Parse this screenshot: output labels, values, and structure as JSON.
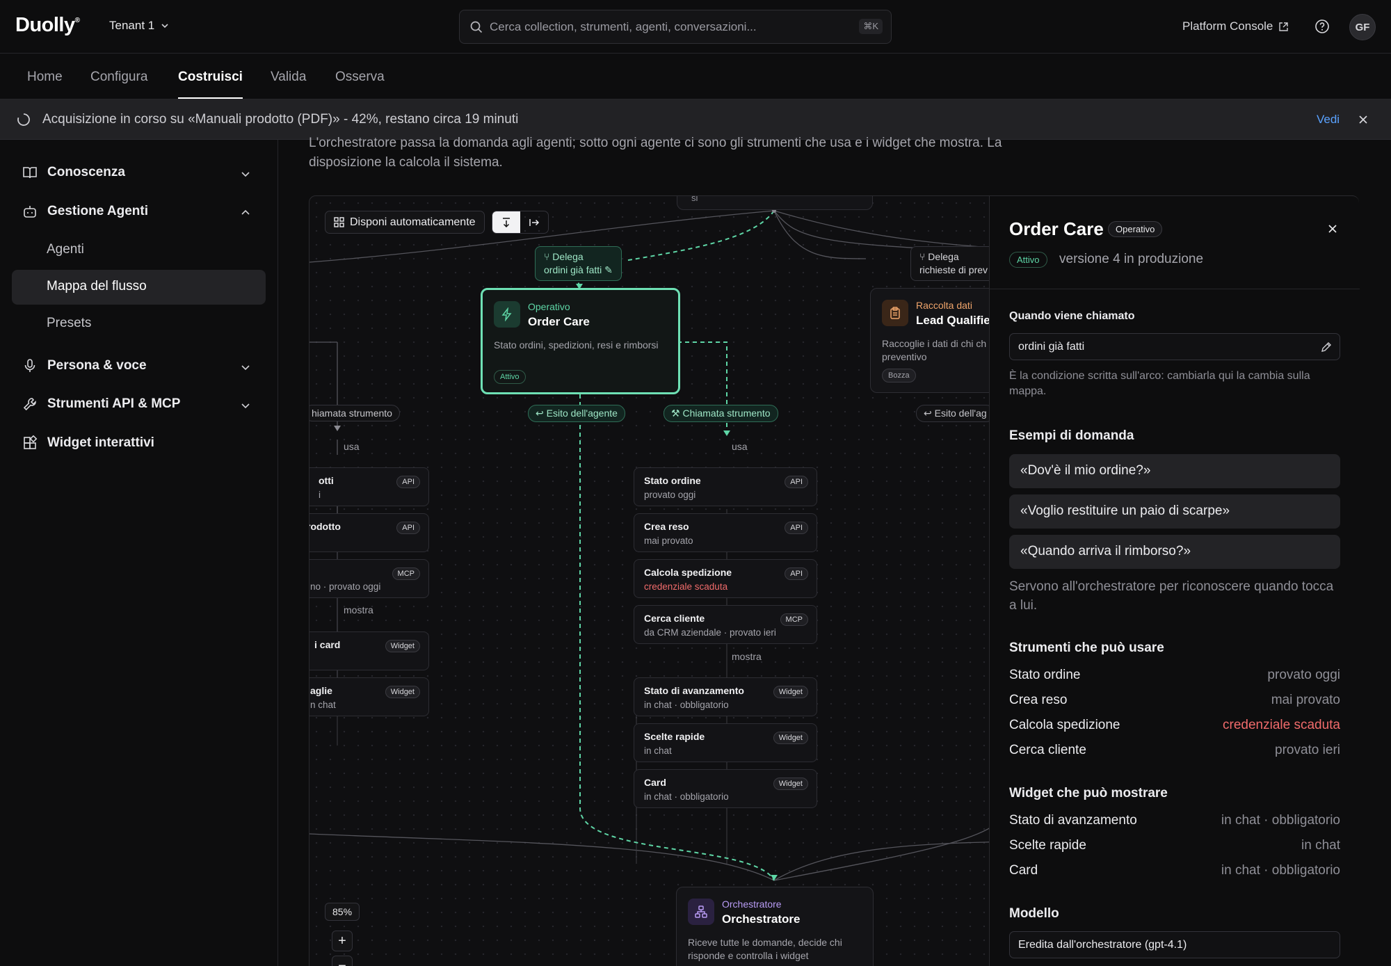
{
  "header": {
    "logo": "Duolly",
    "tenant": "Tenant 1",
    "search_placeholder": "Cerca collection, strumenti, agenti, conversazioni...",
    "search_shortcut": "⌘K",
    "platform_console": "Platform Console",
    "avatar_initials": "GF"
  },
  "nav": {
    "tabs": [
      {
        "label": "Home"
      },
      {
        "label": "Configura"
      },
      {
        "label": "Costruisci",
        "active": true
      },
      {
        "label": "Valida"
      },
      {
        "label": "Osserva"
      }
    ]
  },
  "banner": {
    "text": "Acquisizione in corso su «Manuali prodotto (PDF)» - 42%, restano circa 19 minuti",
    "progress_percent": 42,
    "action": "Vedi"
  },
  "sidebar": {
    "sections": [
      {
        "label": "Conoscenza",
        "icon": "book-icon",
        "expanded": false
      },
      {
        "label": "Gestione Agenti",
        "icon": "bot-icon",
        "expanded": true,
        "items": [
          {
            "label": "Agenti"
          },
          {
            "label": "Mappa del flusso",
            "active": true
          },
          {
            "label": "Presets"
          }
        ]
      },
      {
        "label": "Persona & voce",
        "icon": "mic-icon",
        "expanded": false
      },
      {
        "label": "Strumenti API & MCP",
        "icon": "wrench-icon",
        "expanded": false
      },
      {
        "label": "Widget interattivi",
        "icon": "widgets-icon"
      }
    ]
  },
  "main": {
    "description": "L'orchestratore passa la domanda agli agenti; sotto ogni agente ci sono gli strumenti che usa e i widget che mostra. La disposizione la calcola il sistema.",
    "toolbar": {
      "auto_layout": "Disponi automaticamente"
    },
    "zoom": "85%"
  },
  "flow": {
    "edge_labels": {
      "delega_line1": "Delega",
      "delega_line2": "ordini già fatti",
      "delega2_line1": "Delega",
      "delega2_line2": "richieste di prev",
      "esito": "Esito dell'agente",
      "esito2": "Esito dell'ag",
      "chiamata": "Chiamata strumento",
      "chiamata_left": "hiamata strumento",
      "usa": "usa",
      "mostra": "mostra",
      "top_stub": "si"
    },
    "order_care": {
      "kind": "Operativo",
      "title": "Order Care",
      "desc": "Stato ordini, spedizioni, resi e rimborsi",
      "status": "Attivo"
    },
    "lead": {
      "kind": "Raccolta dati",
      "title": "Lead Qualifier",
      "desc_line1": "Raccoglie i dati di chi ch",
      "desc_line2": "preventivo",
      "status": "Bozza"
    },
    "orchestrator": {
      "kind": "Orchestratore",
      "title": "Orchestratore",
      "desc_line1": "Riceve tutte le domande, decide chi",
      "desc_line2": "risponde e controlla i widget"
    },
    "tools": [
      {
        "name": "Stato ordine",
        "sub": "provato oggi",
        "badge": "API"
      },
      {
        "name": "Crea reso",
        "sub": "mai provato",
        "badge": "API"
      },
      {
        "name": "Calcola spedizione",
        "sub": "credenziale scaduta",
        "badge": "API",
        "error": true
      },
      {
        "name": "Cerca cliente",
        "sub": "da CRM aziendale · provato ieri",
        "badge": "MCP"
      }
    ],
    "widgets": [
      {
        "name": "Stato di avanzamento",
        "sub": "in chat · obbligatorio",
        "badge": "Widget"
      },
      {
        "name": "Scelte rapide",
        "sub": "in chat",
        "badge": "Widget"
      },
      {
        "name": "Card",
        "sub": "in chat · obbligatorio",
        "badge": "Widget"
      }
    ],
    "left_tools": [
      {
        "name": "otti",
        "sub": "i",
        "badge": "API"
      },
      {
        "name": "rodotto",
        "sub": "",
        "badge": "API"
      },
      {
        "name": "",
        "sub": "no · provato oggi",
        "badge": "MCP"
      }
    ],
    "left_widgets": [
      {
        "name": "i card",
        "sub": "",
        "badge": "Widget"
      },
      {
        "name": "aglie",
        "sub": "n chat",
        "badge": "Widget"
      }
    ]
  },
  "panel": {
    "title": "Order Care",
    "badge": "Operativo",
    "status": "Attivo",
    "version": "versione 4 in produzione",
    "when_called_label": "Quando viene chiamato",
    "when_called_value": "ordini già fatti",
    "when_called_hint": "È la condizione scritta sull'arco: cambiarla qui la cambia sulla mappa.",
    "examples_label": "Esempi di domanda",
    "examples": [
      "«Dov'è il mio ordine?»",
      "«Voglio restituire un paio di scarpe»",
      "«Quando arriva il rimborso?»"
    ],
    "examples_hint": "Servono all'orchestratore per riconoscere quando tocca a lui.",
    "tools_label": "Strumenti che può usare",
    "tools": [
      {
        "name": "Stato ordine",
        "value": "provato oggi"
      },
      {
        "name": "Crea reso",
        "value": "mai provato"
      },
      {
        "name": "Calcola spedizione",
        "value": "credenziale scaduta",
        "error": true
      },
      {
        "name": "Cerca cliente",
        "value": "provato ieri"
      }
    ],
    "widgets_label": "Widget che può mostrare",
    "widgets": [
      {
        "name": "Stato di avanzamento",
        "value": "in chat · obbligatorio"
      },
      {
        "name": "Scelte rapide",
        "value": "in chat"
      },
      {
        "name": "Card",
        "value": "in chat · obbligatorio"
      }
    ],
    "model_label": "Modello",
    "model_value": "Eredita dall'orchestratore (gpt-4.1)"
  },
  "colors": {
    "accent_green": "#5ed6a6",
    "error_red": "#f06b6b",
    "link_blue": "#5aa2ff",
    "lead_orange": "#f0a56b",
    "orch_purple": "#b99cf5"
  }
}
